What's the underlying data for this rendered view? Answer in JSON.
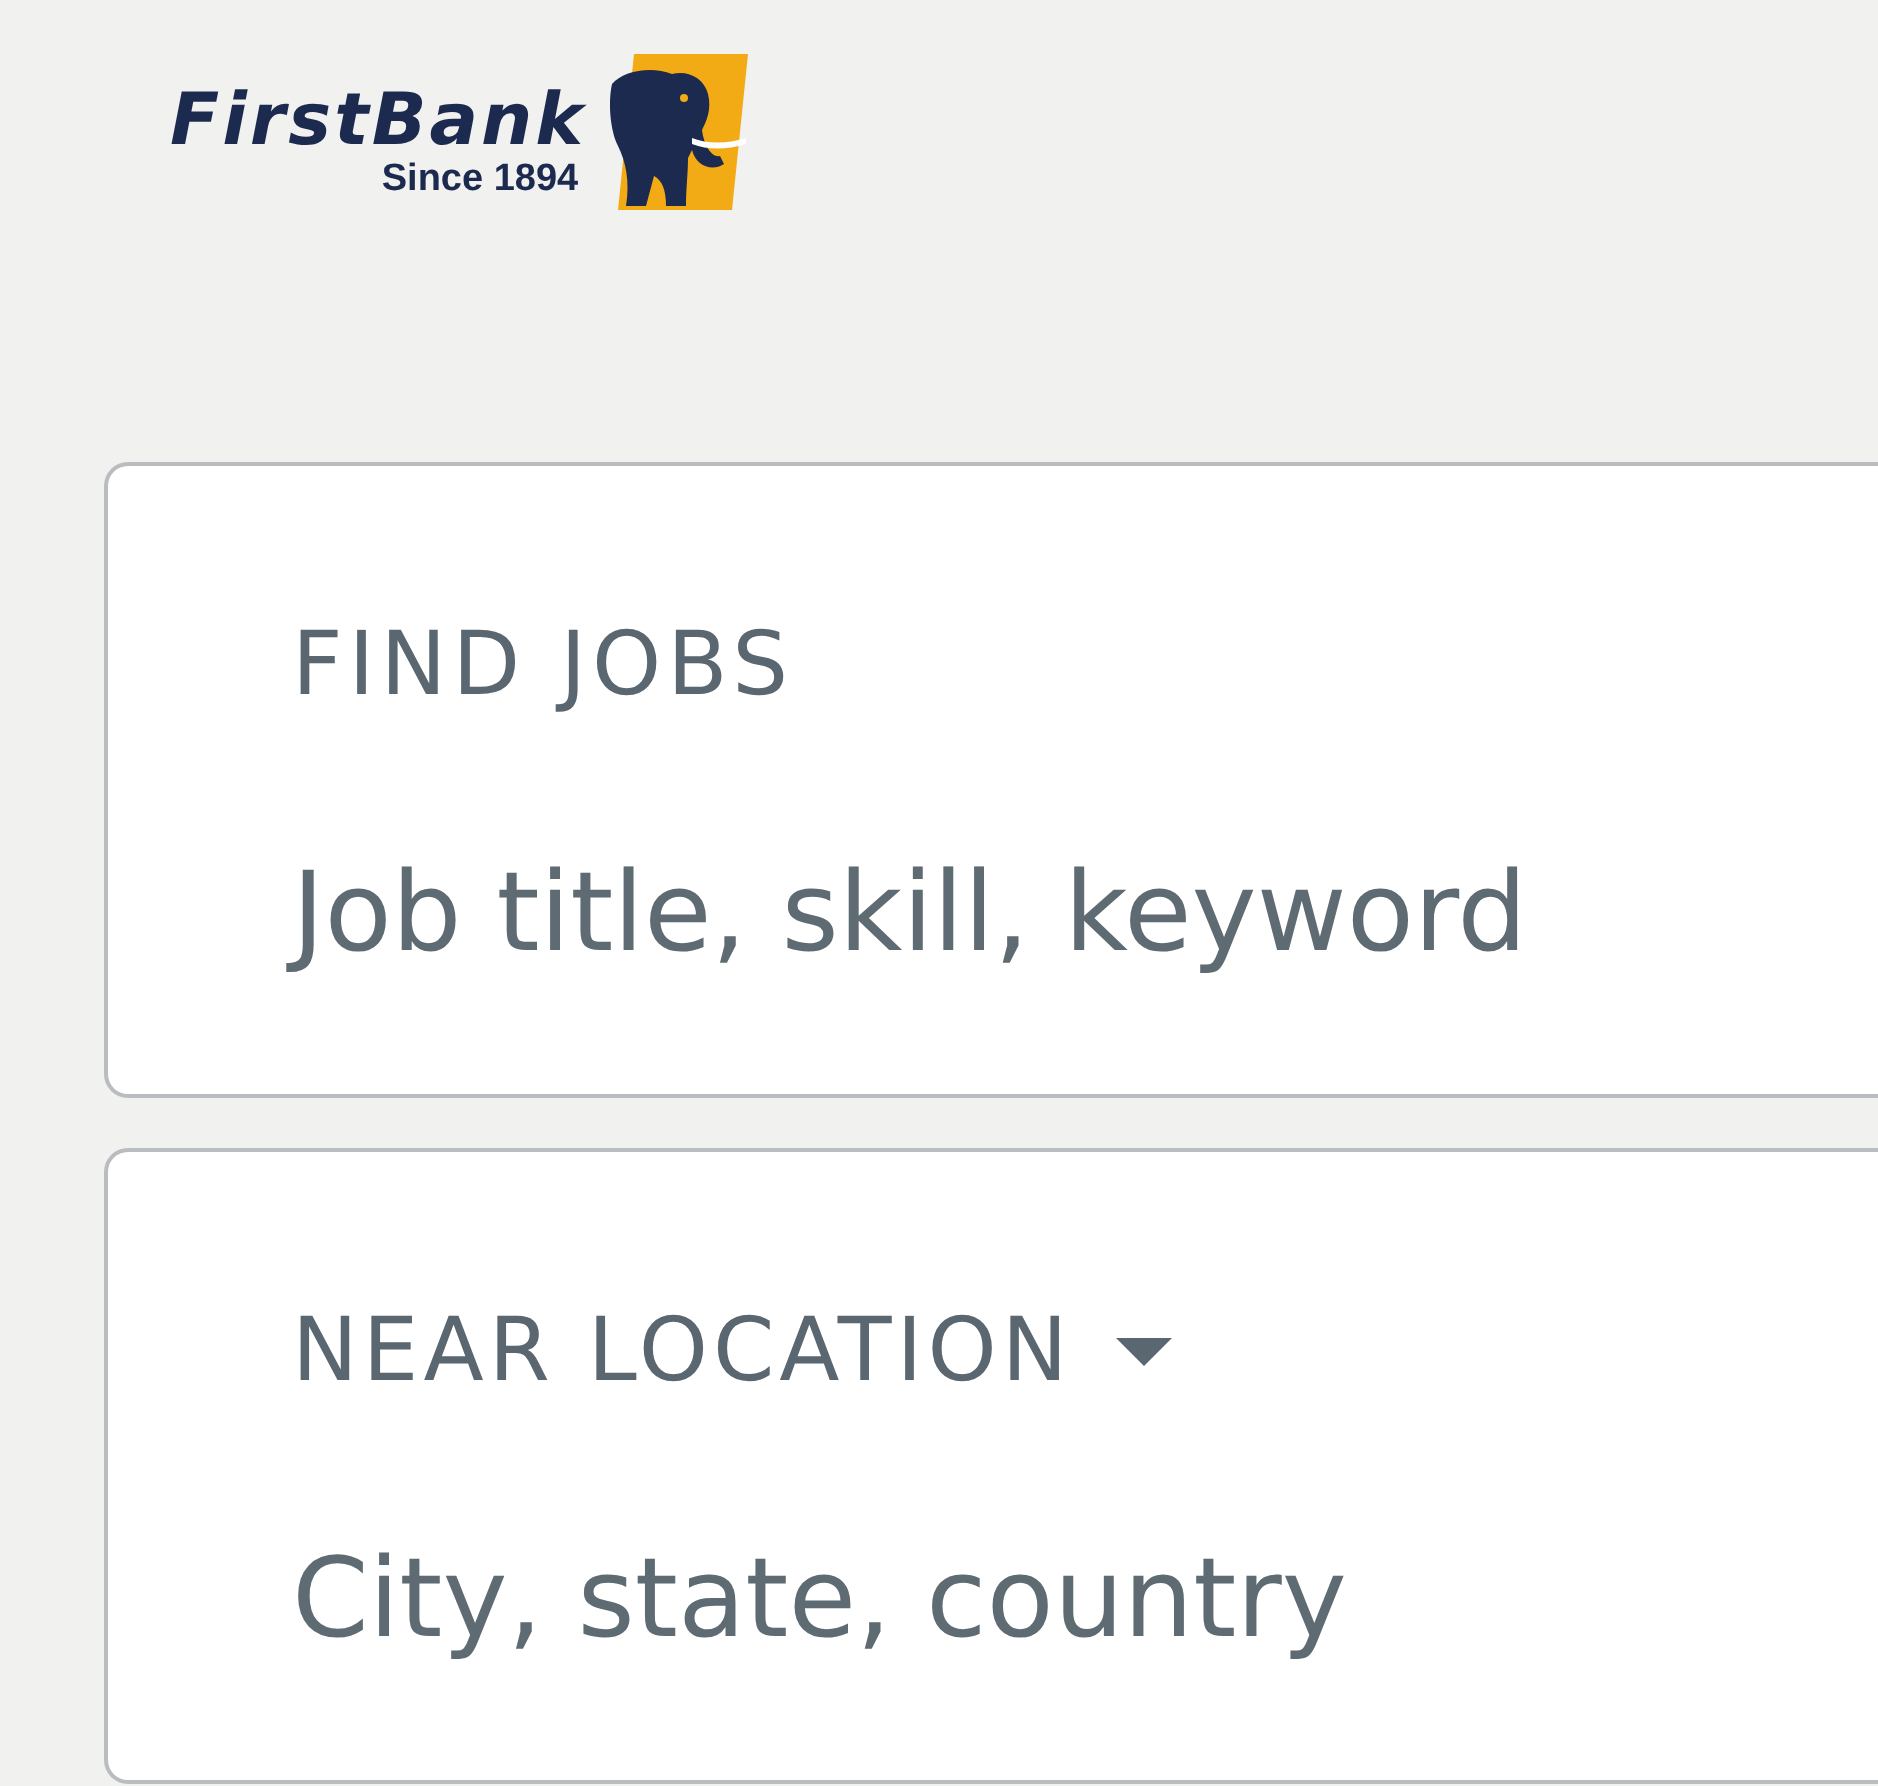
{
  "logo": {
    "name": "FirstBank",
    "tagline": "Since 1894"
  },
  "fields": [
    {
      "kind": "text",
      "label": "FIND JOBS",
      "placeholder": "Job title, skill, keyword"
    },
    {
      "kind": "dropdown",
      "label": "NEAR LOCATION",
      "placeholder": "City, state, country"
    }
  ]
}
